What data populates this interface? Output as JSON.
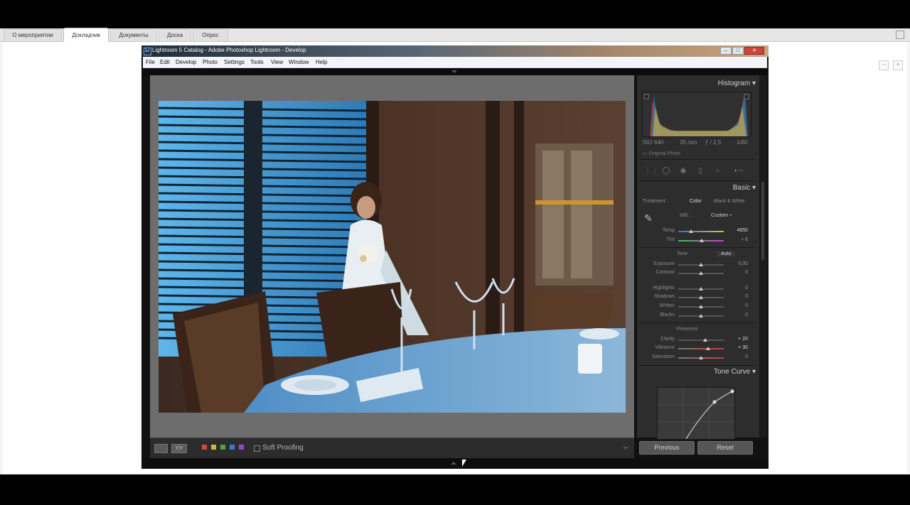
{
  "browser": {
    "tabs": [
      {
        "label": "О мероприятии"
      },
      {
        "label": "Докладчик"
      },
      {
        "label": "Документы"
      },
      {
        "label": "Доска"
      },
      {
        "label": "Опрос"
      }
    ],
    "active_tab": "Докладчик",
    "zoom_out": "−",
    "zoom_in": "+"
  },
  "window": {
    "title": "Lightroom 5 Catalog - Adobe Photoshop Lightroom - Develop",
    "app_icon": "Lr",
    "minimize": "–",
    "maximize": "□",
    "close": "✕"
  },
  "menu": [
    "File",
    "Edit",
    "Develop",
    "Photo",
    "Settings",
    "Tools",
    "View",
    "Window",
    "Help"
  ],
  "histogram": {
    "title": "Histogram",
    "iso": "ISO 640",
    "focal": "35 mm",
    "aperture": "ƒ / 2,5",
    "shutter": "1/80",
    "original_photo": "Original Photo"
  },
  "basic": {
    "title": "Basic",
    "treatment_label": "Treatment :",
    "color": "Color",
    "bw": "Black & White",
    "wb_label": "WB :",
    "wb_value": "Custom ÷",
    "tone_label": "Tone",
    "auto": "Auto",
    "presence_label": "Presence",
    "sliders": [
      {
        "label": "Temp",
        "value": "4650",
        "pos": 0.28
      },
      {
        "label": "Tint",
        "value": "+ 6",
        "pos": 0.52
      },
      {
        "label": "Exposure",
        "value": "0,00",
        "pos": 0.5
      },
      {
        "label": "Contrast",
        "value": "0",
        "pos": 0.5
      },
      {
        "label": "Highlights",
        "value": "0",
        "pos": 0.5
      },
      {
        "label": "Shadows",
        "value": "0",
        "pos": 0.5
      },
      {
        "label": "Whites",
        "value": "0",
        "pos": 0.5
      },
      {
        "label": "Blacks",
        "value": "0",
        "pos": 0.5
      },
      {
        "label": "Clarity",
        "value": "+ 20",
        "pos": 0.6
      },
      {
        "label": "Vibrance",
        "value": "+ 30",
        "pos": 0.65
      },
      {
        "label": "Saturation",
        "value": "0",
        "pos": 0.5
      }
    ]
  },
  "tone_curve": {
    "title": "Tone Curve"
  },
  "buttons": {
    "previous": "Previous",
    "reset": "Reset"
  },
  "filmstrip": {
    "soft_proofing": "Soft Proofing",
    "compare": "Y|Y",
    "colors": [
      "#d24a3a",
      "#d2b63a",
      "#4fa34a",
      "#3a78d2",
      "#8e4ad2"
    ]
  },
  "icons": {
    "eyedropper": "eyedropper-icon",
    "crop": "crop-icon",
    "spot": "spot-removal-icon",
    "redeye": "red-eye-icon",
    "gradient": "graduated-filter-icon",
    "radial": "radial-filter-icon",
    "brush": "adjustment-brush-icon"
  }
}
